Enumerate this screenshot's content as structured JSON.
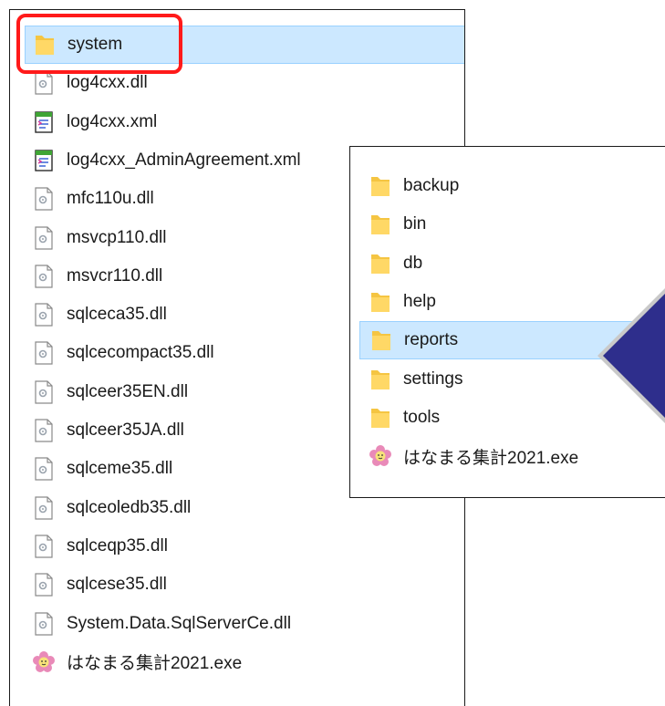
{
  "left_panel": {
    "items": [
      {
        "label": "system",
        "icon": "folder-icon",
        "selected": true
      },
      {
        "label": "log4cxx.dll",
        "icon": "dll-file-icon"
      },
      {
        "label": "log4cxx.xml",
        "icon": "xml-file-icon"
      },
      {
        "label": "log4cxx_AdminAgreement.xml",
        "icon": "xml-file-icon"
      },
      {
        "label": "mfc110u.dll",
        "icon": "dll-file-icon"
      },
      {
        "label": "msvcp110.dll",
        "icon": "dll-file-icon"
      },
      {
        "label": "msvcr110.dll",
        "icon": "dll-file-icon"
      },
      {
        "label": "sqlceca35.dll",
        "icon": "dll-file-icon"
      },
      {
        "label": "sqlcecompact35.dll",
        "icon": "dll-file-icon"
      },
      {
        "label": "sqlceer35EN.dll",
        "icon": "dll-file-icon"
      },
      {
        "label": "sqlceer35JA.dll",
        "icon": "dll-file-icon"
      },
      {
        "label": "sqlceme35.dll",
        "icon": "dll-file-icon"
      },
      {
        "label": "sqlceoledb35.dll",
        "icon": "dll-file-icon"
      },
      {
        "label": "sqlceqp35.dll",
        "icon": "dll-file-icon"
      },
      {
        "label": "sqlcese35.dll",
        "icon": "dll-file-icon"
      },
      {
        "label": "System.Data.SqlServerCe.dll",
        "icon": "dll-file-icon"
      },
      {
        "label": "はなまる集計2021.exe",
        "icon": "flower-app-icon"
      }
    ]
  },
  "right_panel": {
    "items": [
      {
        "label": "backup",
        "icon": "folder-icon"
      },
      {
        "label": "bin",
        "icon": "folder-icon"
      },
      {
        "label": "db",
        "icon": "folder-icon"
      },
      {
        "label": "help",
        "icon": "folder-icon"
      },
      {
        "label": "reports",
        "icon": "folder-icon",
        "selected": true
      },
      {
        "label": "settings",
        "icon": "folder-icon"
      },
      {
        "label": "tools",
        "icon": "folder-icon"
      },
      {
        "label": "はなまる集計2021.exe",
        "icon": "flower-app-icon"
      }
    ]
  },
  "colors": {
    "selection_bg": "#cce8ff",
    "highlight_red": "#ff1a1a",
    "arrow_navy": "#2e2e8c"
  }
}
